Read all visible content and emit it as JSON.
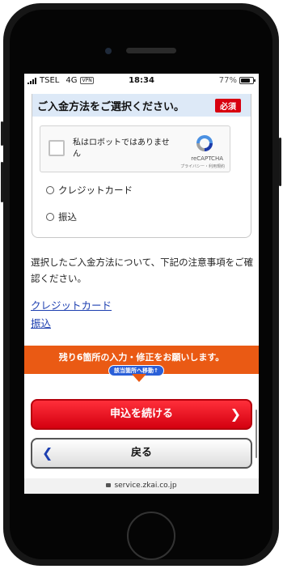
{
  "status_bar": {
    "carrier": "TSEL",
    "network": "4G",
    "vpn": "VPN",
    "time": "18:34",
    "battery": "77%",
    "battery_level": 0.77
  },
  "payment_section": {
    "title": "ご入金方法をご選択ください。",
    "required_badge": "必須",
    "recaptcha": {
      "label": "私はロボットではありません",
      "brand": "reCAPTCHA",
      "links": "プライバシー・利用規約"
    },
    "options": [
      "クレジットカード",
      "振込"
    ]
  },
  "note": "選択したご入金方法について、下記の注意事項をご確認ください。",
  "links": [
    "クレジットカード",
    "振込"
  ],
  "banner": {
    "text": "残り6箇所の入力・修正をお願いします。",
    "jump": "該当箇所へ移動↑"
  },
  "buttons": {
    "continue": "申込を続ける",
    "back": "戻る"
  },
  "url": "service.zkai.co.jp",
  "colors": {
    "accent_red": "#d8000f",
    "banner_orange": "#ea5a14",
    "link_blue": "#1d3fb0",
    "header_blue": "#dde9f7"
  }
}
